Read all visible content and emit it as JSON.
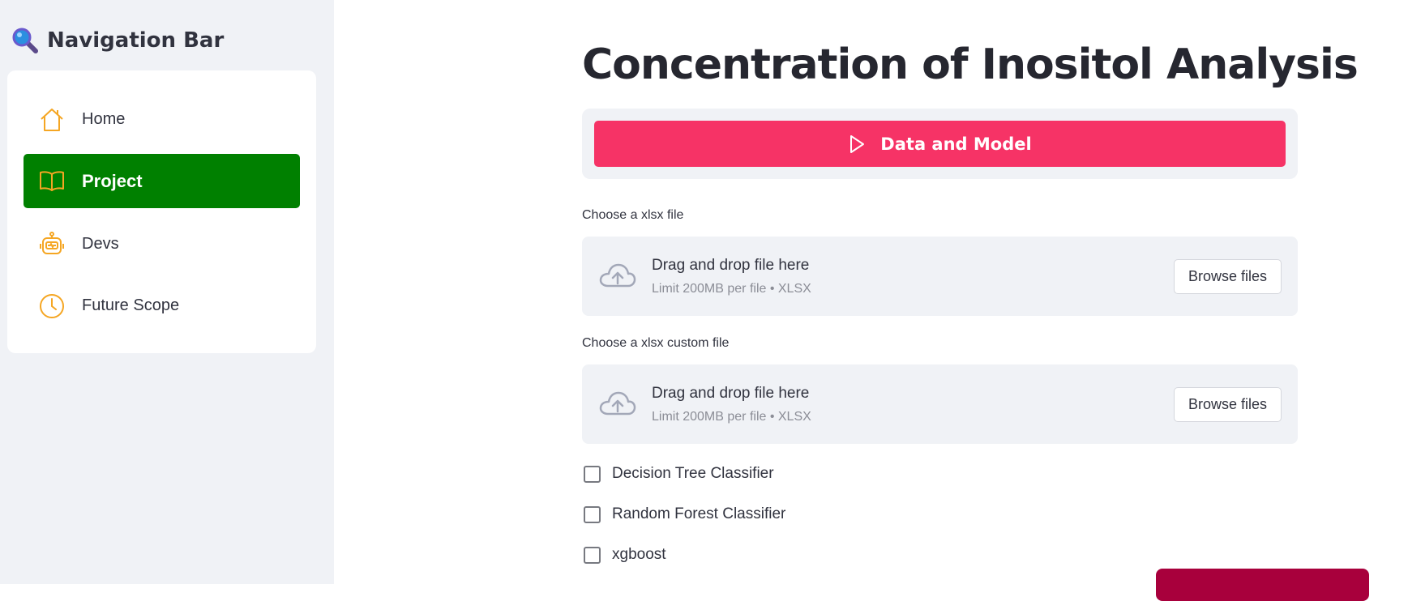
{
  "sidebar": {
    "title": "Navigation Bar",
    "items": [
      {
        "label": "Home",
        "icon": "house-icon"
      },
      {
        "label": "Project",
        "icon": "book-icon",
        "active": true
      },
      {
        "label": "Devs",
        "icon": "robot-icon"
      },
      {
        "label": "Future Scope",
        "icon": "clock-icon"
      }
    ]
  },
  "main": {
    "title": "Concentration of Inositol Analysis",
    "run_button_label": "Data and Model",
    "uploaders": [
      {
        "label": "Choose a xlsx file",
        "drop_text": "Drag and drop file here",
        "limit_text": "Limit 200MB per file • XLSX",
        "browse_label": "Browse files"
      },
      {
        "label": "Choose a xlsx custom file",
        "drop_text": "Drag and drop file here",
        "limit_text": "Limit 200MB per file • XLSX",
        "browse_label": "Browse files"
      }
    ],
    "checkboxes": [
      {
        "label": "Decision Tree Classifier",
        "checked": false
      },
      {
        "label": "Random Forest Classifier",
        "checked": false
      },
      {
        "label": "xgboost",
        "checked": false
      }
    ]
  },
  "colors": {
    "sidebar_bg": "#f0f2f6",
    "active_nav": "#008000",
    "nav_icon": "#f5a623",
    "primary_button": "#f63366",
    "title_text": "#262730"
  }
}
